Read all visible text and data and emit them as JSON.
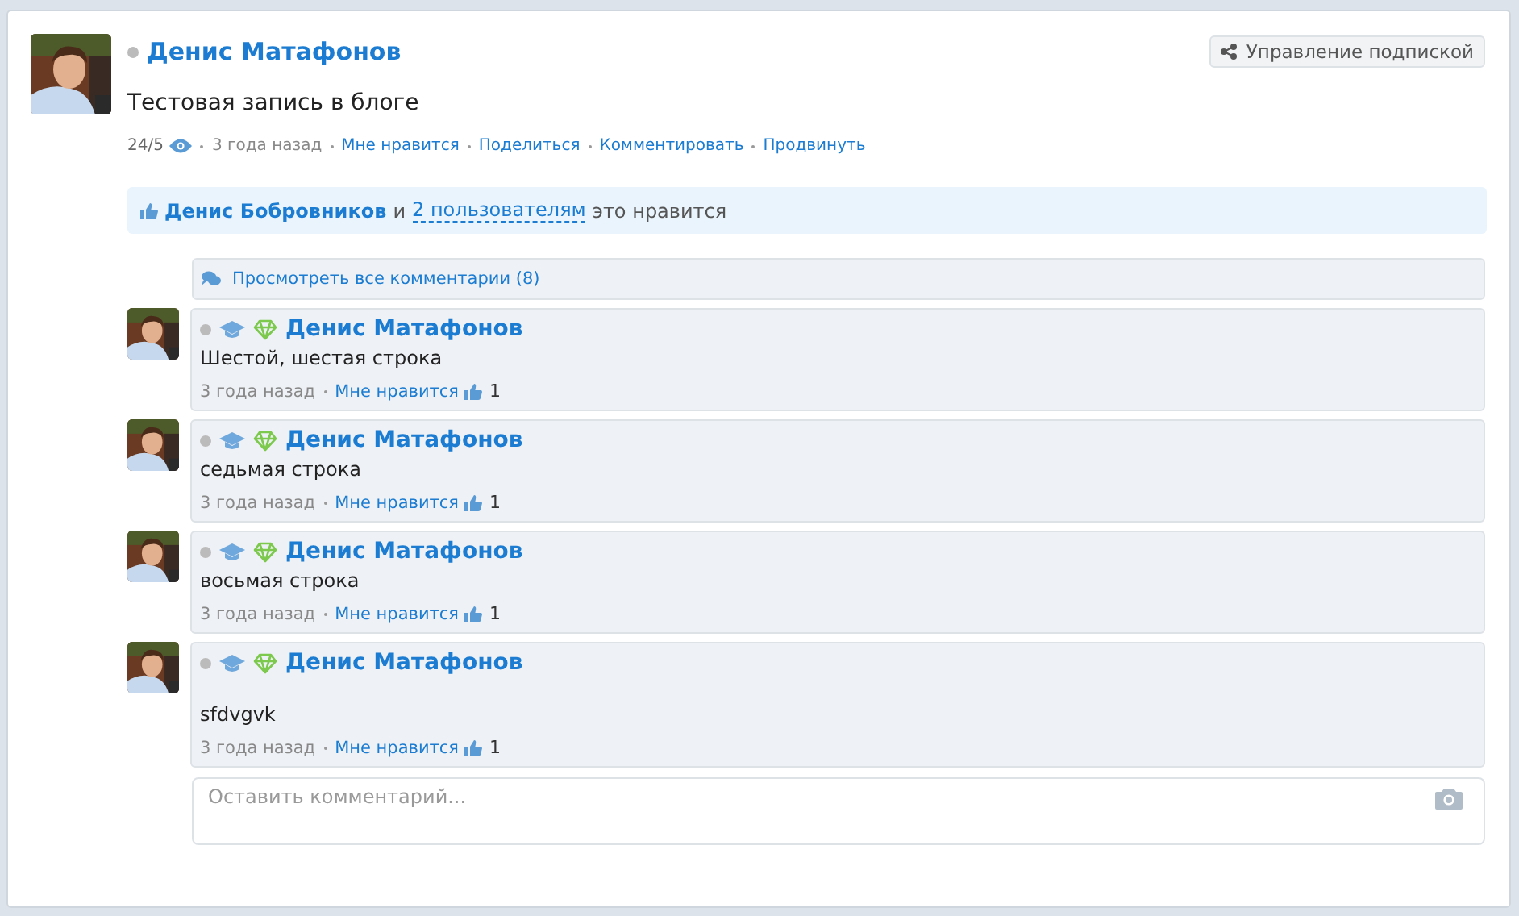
{
  "post": {
    "author": {
      "name": "Денис Матафонов",
      "online": false
    },
    "subscription_button": "Управление подпиской",
    "text": "Тестовая запись в блоге",
    "views": "24/5",
    "time": "3 года назад",
    "actions": [
      "Мне нравится",
      "Поделиться",
      "Комментировать",
      "Продвинуть"
    ],
    "likes": {
      "user": "Денис Бобровников",
      "conjunction": "и",
      "others": "2 пользователям",
      "suffix": "это нравится"
    }
  },
  "view_all_comments": "Просмотреть все комментарии (8)",
  "comments": [
    {
      "author": "Денис Матафонов",
      "online": false,
      "text": "Шестой, шестая строка",
      "time": "3 года назад",
      "like": "Мне нравится",
      "like_count": "1"
    },
    {
      "author": "Денис Матафонов",
      "online": false,
      "text": "седьмая строка",
      "time": "3 года назад",
      "like": "Мне нравится",
      "like_count": "1"
    },
    {
      "author": "Денис Матафонов",
      "online": false,
      "text": "восьмая строка",
      "time": "3 года назад",
      "like": "Мне нравится",
      "like_count": "1"
    },
    {
      "author": "Денис Матафонов",
      "online": false,
      "text": "\nsfdvgvk",
      "time": "3 года назад",
      "like": "Мне нравится",
      "like_count": "1"
    }
  ],
  "comment_field": {
    "placeholder": "Оставить комментарий..."
  }
}
